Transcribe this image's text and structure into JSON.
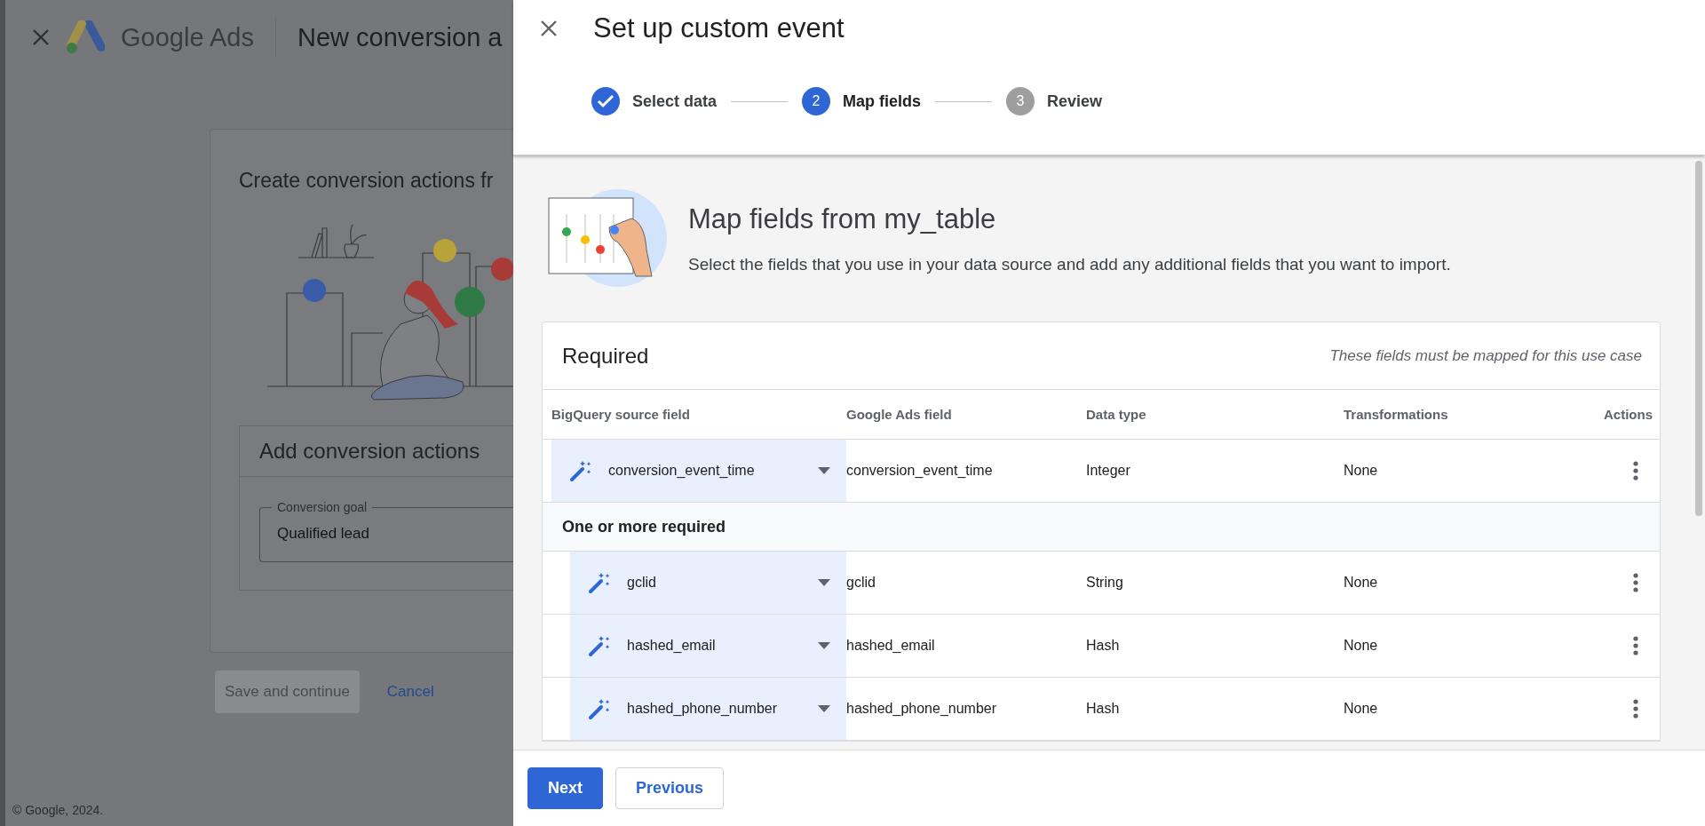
{
  "background_page": {
    "header": {
      "product": "Google Ads",
      "title": "New conversion a"
    },
    "card": {
      "title": "Create conversion actions fr",
      "section_title": "Add conversion actions",
      "field": {
        "label": "Conversion goal",
        "value": "Qualified lead"
      }
    },
    "buttons": [
      {
        "label": "Save and continue",
        "disabled": true
      },
      {
        "label": "Cancel",
        "disabled": false
      }
    ],
    "footer": "© Google, 2024."
  },
  "panel": {
    "title": "Set up custom event",
    "steps": [
      {
        "label": "Select data",
        "completed": true,
        "selected": false
      },
      {
        "number": "2",
        "label": "Map fields",
        "completed": false,
        "selected": true
      },
      {
        "number": "3",
        "label": "Review",
        "completed": false,
        "selected": false
      }
    ],
    "intro": {
      "title": "Map fields from my_table",
      "description": "Select the fields that you use in your data source and add any additional fields that you want to import."
    },
    "table": {
      "title": "Required",
      "note": "These fields must be mapped for this use case",
      "columns": [
        "BigQuery source field",
        "Google Ads field",
        "Data type",
        "Transformations",
        "Actions"
      ],
      "rows": [
        {
          "kind": "field",
          "source": "conversion_event_time",
          "google_ads_field": "conversion_event_time",
          "data_type": "Integer",
          "transformations": "None"
        },
        {
          "kind": "group",
          "label": "One or more required",
          "children": [
            {
              "kind": "field",
              "source": "gclid",
              "google_ads_field": "gclid",
              "data_type": "String",
              "transformations": "None"
            },
            {
              "kind": "field",
              "source": "hashed_email",
              "google_ads_field": "hashed_email",
              "data_type": "Hash",
              "transformations": "None"
            },
            {
              "kind": "field",
              "source": "hashed_phone_number",
              "google_ads_field": "hashed_phone_number",
              "data_type": "Hash",
              "transformations": "None"
            }
          ]
        }
      ]
    },
    "footer_buttons": [
      {
        "label": "Next",
        "kind": "primary"
      },
      {
        "label": "Previous",
        "kind": "secondary"
      }
    ]
  }
}
